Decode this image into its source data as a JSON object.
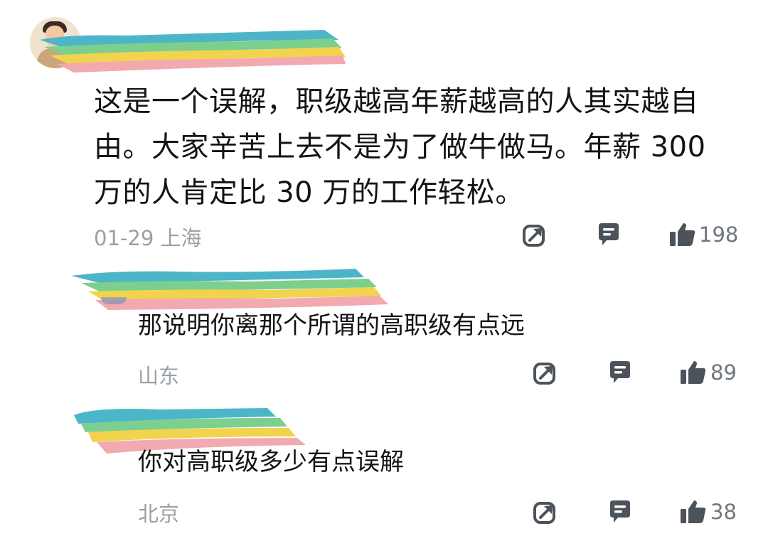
{
  "comment": {
    "text": "这是一个误解，职级越高年薪越高的人其实越自由。大家辛苦上去不是为了做牛做马。年薪 300 万的人肯定比 30 万的工作轻松。",
    "meta": "01-29  上海",
    "likes": "198"
  },
  "replies": [
    {
      "text": "那说明你离那个所谓的高职级有点远",
      "meta": "山东",
      "likes": "89"
    },
    {
      "text": "你对高职级多少有点误解",
      "meta": "北京",
      "likes": "38"
    }
  ],
  "icons": {
    "share": "share-arrow-icon",
    "reply": "comment-bubble-icon",
    "like": "thumbs-up-icon"
  },
  "colors": {
    "icon": "#4d535a",
    "meta": "#9aa0a6",
    "text": "#141414",
    "redaction_bands": [
      "#4db5c8",
      "#7ccf8d",
      "#f2d34e",
      "#f2a9b0"
    ]
  }
}
